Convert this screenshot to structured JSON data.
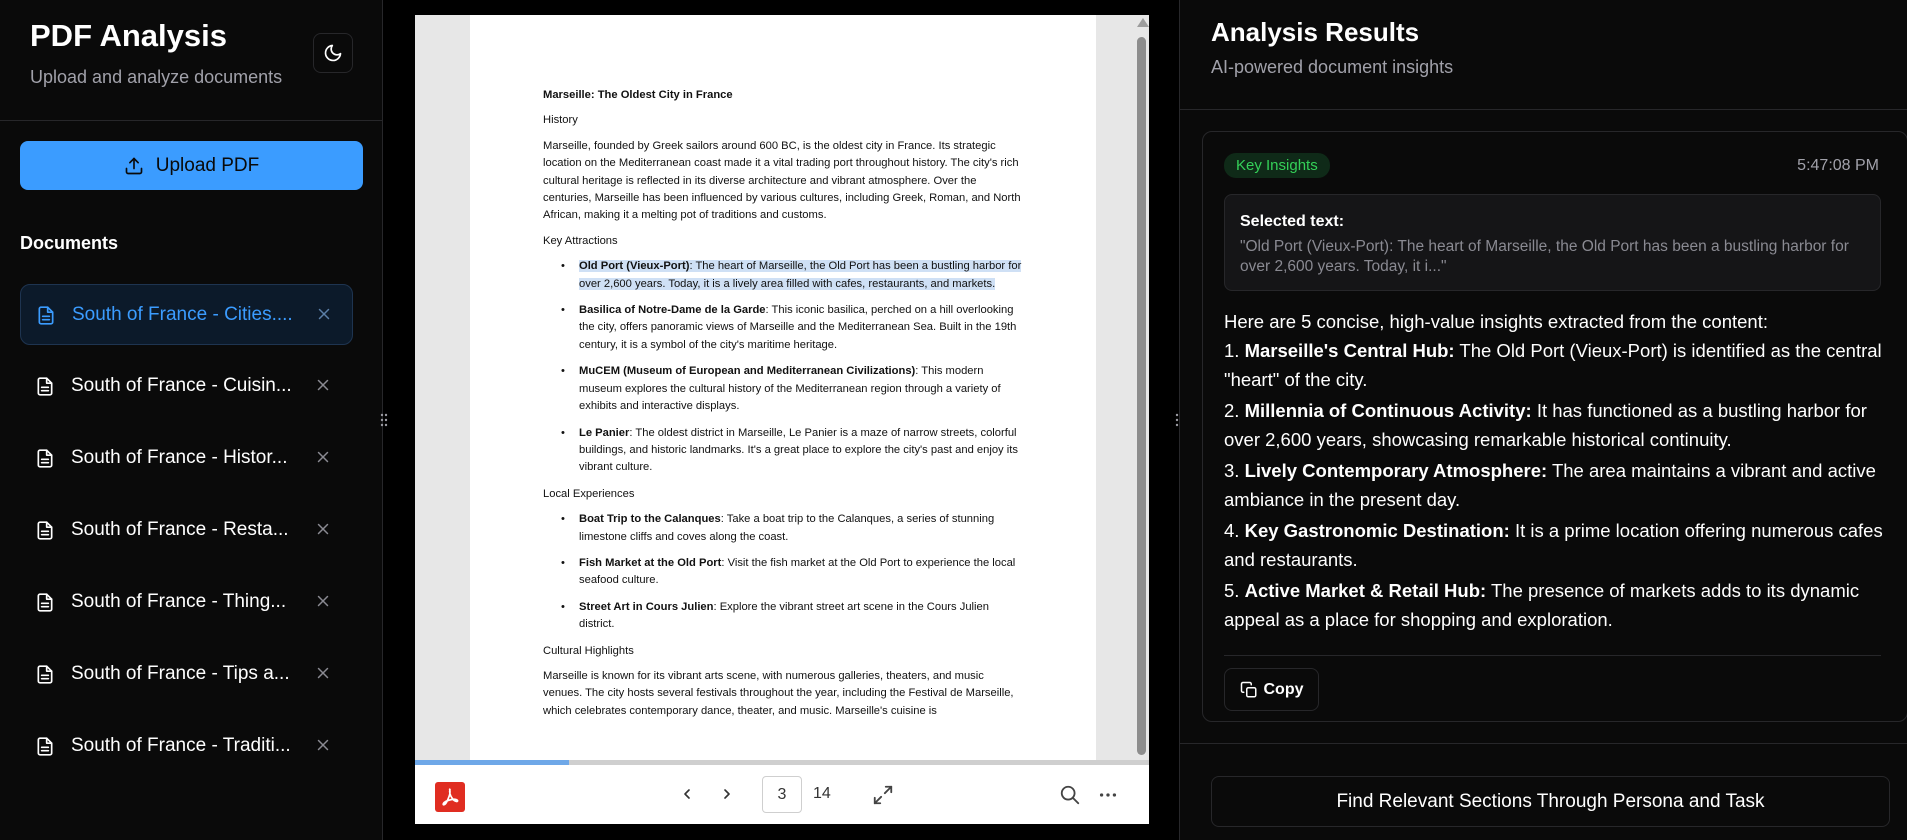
{
  "sidebar": {
    "title": "PDF Analysis",
    "subtitle": "Upload and analyze documents",
    "theme_icon": "moon-icon",
    "upload_label": "Upload PDF",
    "documents_heading": "Documents",
    "documents": [
      {
        "label": "South of France - Cities....",
        "active": true
      },
      {
        "label": "South of France - Cuisin...",
        "active": false
      },
      {
        "label": "South of France - Histor...",
        "active": false
      },
      {
        "label": "South of France - Resta...",
        "active": false
      },
      {
        "label": "South of France - Thing...",
        "active": false
      },
      {
        "label": "South of France - Tips a...",
        "active": false
      },
      {
        "label": "South of France - Traditi...",
        "active": false
      }
    ]
  },
  "pdf": {
    "title": "Marseille: The Oldest City in France",
    "history_heading": "History",
    "history_text": "Marseille, founded by Greek sailors around 600 BC, is the oldest city in France. Its strategic location on the Mediterranean coast made it a vital trading port throughout history. The city's rich cultural heritage is reflected in its diverse architecture and vibrant atmosphere. Over the centuries, Marseille has been influenced by various cultures, including Greek, Roman, and North African, making it a melting pot of traditions and customs.",
    "attractions_heading": "Key Attractions",
    "attractions": [
      {
        "name": "Old Port (Vieux-Port)",
        "text": ": The heart of Marseille, the Old Port has been a bustling harbor for over 2,600 years. Today, it is a lively area filled with cafes, restaurants, and markets.",
        "highlighted": true
      },
      {
        "name": "Basilica of Notre-Dame de la Garde",
        "text": ": This iconic basilica, perched on a hill overlooking the city, offers panoramic views of Marseille and the Mediterranean Sea. Built in the 19th century, it is a symbol of the city's maritime heritage.",
        "highlighted": false
      },
      {
        "name": "MuCEM (Museum of European and Mediterranean Civilizations)",
        "text": ": This modern museum explores the cultural history of the Mediterranean region through a variety of exhibits and interactive displays.",
        "highlighted": false
      },
      {
        "name": "Le Panier",
        "text": ": The oldest district in Marseille, Le Panier is a maze of narrow streets, colorful buildings, and historic landmarks. It's a great place to explore the city's past and enjoy its vibrant culture.",
        "highlighted": false
      }
    ],
    "experiences_heading": "Local Experiences",
    "experiences": [
      {
        "name": "Boat Trip to the Calanques",
        "text": ": Take a boat trip to the Calanques, a series of stunning limestone cliffs and coves along the coast."
      },
      {
        "name": "Fish Market at the Old Port",
        "text": ": Visit the fish market at the Old Port to experience the local seafood culture."
      },
      {
        "name": "Street Art in Cours Julien",
        "text": ": Explore the vibrant street art scene in the Cours Julien district."
      }
    ],
    "cultural_heading": "Cultural Highlights",
    "cultural_text": "Marseille is known for its vibrant arts scene, with numerous galleries, theaters, and music venues. The city hosts several festivals throughout the year, including the Festival de Marseille, which celebrates contemporary dance, theater, and music. Marseille's cuisine is",
    "current_page": "3",
    "total_pages": "14",
    "progress_fraction": 0.21
  },
  "results": {
    "title": "Analysis Results",
    "subtitle": "AI-powered document insights",
    "badge": "Key Insights",
    "timestamp": "5:47:08 PM",
    "selected_label": "Selected text:",
    "selected_text": "\"Old Port (Vieux-Port): The heart of Marseille, the Old Port has been a bustling harbor for over 2,600 years. Today, it i...\"",
    "intro": "Here are 5 concise, high-value insights extracted from the content:",
    "insights": [
      {
        "num": "1.",
        "head": "Marseille's Central Hub:",
        "body": "The Old Port (Vieux-Port) is identified as the central \"heart\" of the city."
      },
      {
        "num": "2.",
        "head": "Millennia of Continuous Activity:",
        "body": "It has functioned as a bustling harbor for over 2,600 years, showcasing remarkable historical continuity."
      },
      {
        "num": "3.",
        "head": "Lively Contemporary Atmosphere:",
        "body": "The area maintains a vibrant and active ambiance in the present day."
      },
      {
        "num": "4.",
        "head": "Key Gastronomic Destination:",
        "body": "It is a prime location offering numerous cafes and restaurants."
      },
      {
        "num": "5.",
        "head": "Active Market & Retail Hub:",
        "body": "The presence of markets adds to its dynamic appeal as a place for shopping and exploration."
      }
    ],
    "copy_label": "Copy",
    "find_label": "Find Relevant Sections Through Persona and Task"
  },
  "colors": {
    "accent": "#3b9cff",
    "badge_green": "#34d058",
    "pdf_red": "#e02d21",
    "highlight": "#cfe0f5"
  }
}
